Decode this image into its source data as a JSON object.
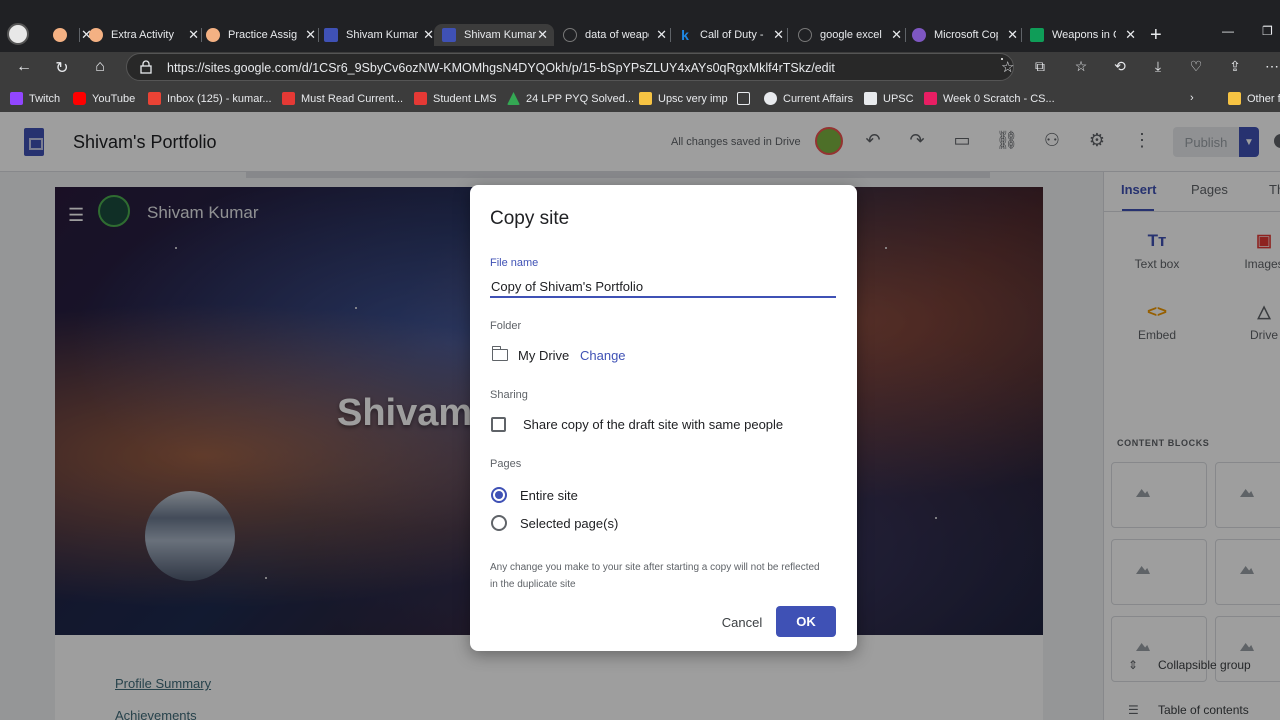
{
  "browser": {
    "tabs": [
      {
        "title": "",
        "favicon_color": "#f4b183"
      },
      {
        "title": "Extra Activity",
        "favicon_color": "#f4b183"
      },
      {
        "title": "Practice Assig",
        "favicon_color": "#f4b183"
      },
      {
        "title": "Shivam Kumar",
        "favicon_color": "#3f51b5"
      },
      {
        "title": "Shivam Kumar",
        "favicon_color": "#3f51b5"
      },
      {
        "title": "data of weapo",
        "favicon_color": "#202124"
      },
      {
        "title": "Call of Duty -",
        "favicon_color": "#1e88e5"
      },
      {
        "title": "google excel",
        "favicon_color": "#202124"
      },
      {
        "title": "Microsoft Cop",
        "favicon_color": "#7e57c2"
      },
      {
        "title": "Weapons in C",
        "favicon_color": "#0f9d58"
      }
    ],
    "url": "https://sites.google.com/d/1CSr6_9SbyCv6ozNW-KMOMhgsN4DYQOkh/p/15-bSpYPsZLUY4xAYs0qRgxMklf4rTSkz/edit",
    "bookmarks": [
      {
        "label": "Twitch",
        "color": "#9146ff"
      },
      {
        "label": "YouTube",
        "color": "#ff0000"
      },
      {
        "label": "Inbox (125) - kumar...",
        "color": "#ea4335"
      },
      {
        "label": "Must Read Current...",
        "color": "#e53935"
      },
      {
        "label": "Student LMS",
        "color": "#e53935"
      },
      {
        "label": "24 LPP PYQ Solved...",
        "color": "#34a853"
      },
      {
        "label": "Upsc very imp",
        "color": "#f6c343"
      },
      {
        "label": "Current Affairs",
        "color": "#e8eaed"
      },
      {
        "label": "Current Affairs",
        "color": "#e8eaed"
      },
      {
        "label": "UPSC",
        "color": "#e8eaed"
      },
      {
        "label": "Week 0 Scratch - CS...",
        "color": "#e91e63"
      },
      {
        "label": "Other fa",
        "color": "#f6c343"
      }
    ]
  },
  "editor": {
    "title": "Shivam's Portfolio",
    "save_status": "All changes saved in Drive",
    "publish_label": "Publish",
    "hero": {
      "site_name": "Shivam Kumar",
      "title": "Shivam's"
    },
    "page_links": [
      "Profile Summary",
      "Achievements"
    ],
    "side_panel": {
      "tabs": [
        "Insert",
        "Pages",
        "The"
      ],
      "items": [
        {
          "label": "Text box",
          "icon": "Tт"
        },
        {
          "label": "Images",
          "icon": "▣"
        },
        {
          "label": "Embed",
          "icon": "<>"
        },
        {
          "label": "Drive",
          "icon": "△"
        }
      ],
      "section_title": "CONTENT BLOCKS",
      "bottom_items": [
        {
          "label": "Collapsible group",
          "icon": "⇕"
        },
        {
          "label": "Table of contents",
          "icon": "☰"
        }
      ]
    }
  },
  "dialog": {
    "title": "Copy site",
    "file_name_label": "File name",
    "file_name_value": "Copy of Shivam's Portfolio",
    "folder_label": "Folder",
    "folder_name": "My Drive",
    "change_label": "Change",
    "sharing_label": "Sharing",
    "share_checkbox_label": "Share copy of the draft site with same people",
    "share_checked": false,
    "pages_label": "Pages",
    "pages_options": [
      "Entire site",
      "Selected page(s)"
    ],
    "pages_selected": "Entire site",
    "note": "Any change you make to your site after starting a copy will not be reflected in the duplicate site",
    "cancel_label": "Cancel",
    "ok_label": "OK"
  },
  "colors": {
    "accent": "#3f51b5",
    "chrome_dark": "#202124",
    "chrome_toolbar": "#3c3c3c"
  }
}
